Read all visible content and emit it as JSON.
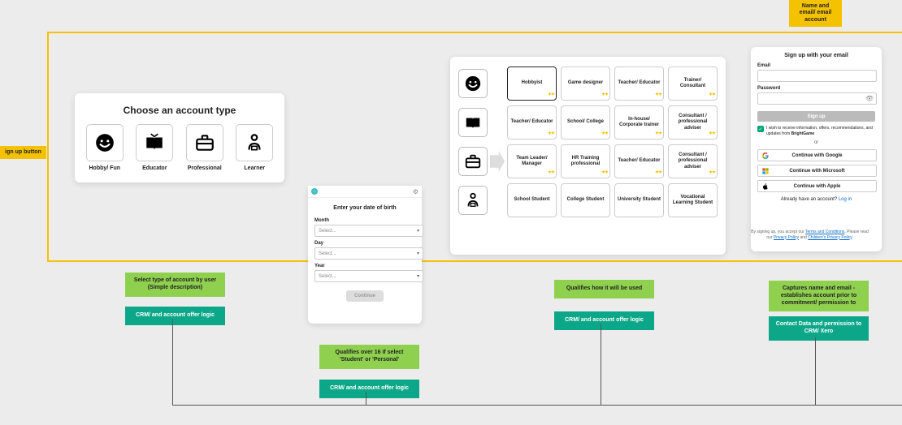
{
  "tags": {
    "signup_button": "ign up button",
    "name_email": "Name and email/ email account"
  },
  "accountType": {
    "title": "Choose an account type",
    "options": [
      "Hobby/ Fun",
      "Educator",
      "Professional",
      "Learner"
    ]
  },
  "dob": {
    "title": "Enter your date of birth",
    "month_lbl": "Month",
    "day_lbl": "Day",
    "year_lbl": "Year",
    "placeholder": "Select...",
    "continue": "Continue"
  },
  "grid": {
    "rows": [
      {
        "cards": [
          "Hobbyist",
          "Game designer",
          "Teacher/ Educator",
          "Trainer/ Consultant"
        ]
      },
      {
        "cards": [
          "Teacher/ Educator",
          "School/ College",
          "In-house/ Corporate trainer",
          "Consultant / professional adviser"
        ]
      },
      {
        "cards": [
          "Team Leader/ Manager",
          "HR Training professional",
          "Teacher/ Educator",
          "Consultant / professional adviser"
        ]
      },
      {
        "cards": [
          "School Student",
          "College Student",
          "University Student",
          "Vocational Learning Student"
        ]
      }
    ]
  },
  "signup": {
    "title": "Sign up with your email",
    "email_lbl": "Email",
    "password_lbl": "Password",
    "signup_btn": "Sign up",
    "or": "or",
    "check_text": "I wish to receive information, offers, recommendations, and updates from ",
    "check_brand": "BrightGame",
    "google": "Continue with Google",
    "microsoft": "Continue with Microsoft",
    "apple": "Continue with Apple",
    "have_account": "Already have an account? ",
    "login": "Log in"
  },
  "legal": {
    "line1_a": "By signing up, you accept our ",
    "terms": "Terms and Conditions",
    "line1_b": ". Please read our ",
    "privacy": "Privacy Policy",
    "and": " and ",
    "childrens": "Children's Privacy Policy",
    "end": "."
  },
  "callouts": {
    "a1": "Select type of account by user (Simple description)",
    "a2": "CRM/ and account offer logic",
    "b1": "Qualifies over 16 if select 'Student' or 'Personal'",
    "b2": "CRM/ and account offer logic",
    "c1": "Qualifies how it will be used",
    "c2": "CRM/ and account offer logic",
    "d1": "Captures name and email - establishes account prior to commitment/ permission to",
    "d2": "Contact Data and permission to CRM/ Xero"
  }
}
